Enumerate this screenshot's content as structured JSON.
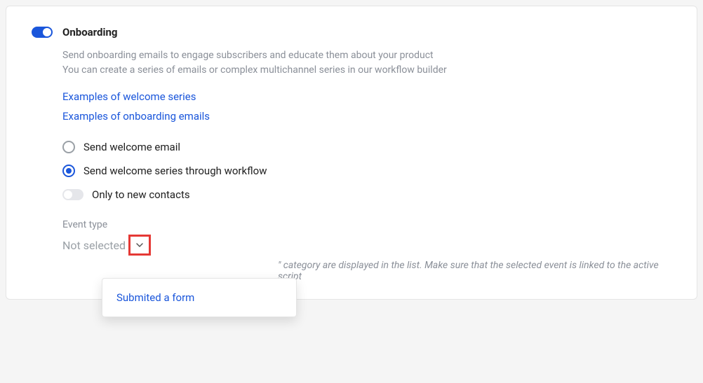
{
  "header": {
    "title": "Onboarding"
  },
  "description": {
    "line1": "Send onboarding emails to engage subscribers and educate them about your product",
    "line2": "You can create a series of emails or complex multichannel series in our workflow builder"
  },
  "links": {
    "examples_welcome": "Examples of welcome series",
    "examples_onboarding": "Examples of onboarding emails"
  },
  "options": {
    "welcome_email": "Send welcome email",
    "welcome_series": "Send welcome series through workflow",
    "new_contacts_only": "Only to new contacts"
  },
  "event_type": {
    "label": "Event type",
    "value": "Not selected",
    "hint_suffix": "\" category are displayed in the list. Make sure that the selected event is linked to the active script",
    "dropdown_option": "Submited a form"
  }
}
